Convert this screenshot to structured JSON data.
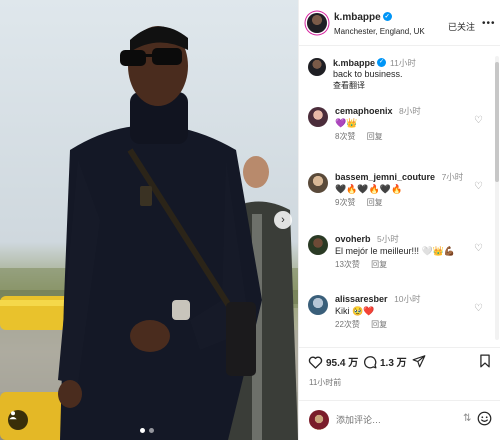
{
  "header": {
    "username": "k.mbappe",
    "location": "Manchester, England, UK",
    "follow_label": "已关注",
    "more_icon": "more-horizontal-icon"
  },
  "caption": {
    "username": "k.mbappe",
    "time": "11小时",
    "text": "back to business.",
    "translate": "查看翻译"
  },
  "comments": [
    {
      "username": "cemaphoenix",
      "time": "8小时",
      "text": "💜👑",
      "likes": "8次赞",
      "reply": "回复"
    },
    {
      "username": "bassem_jemni_couture",
      "time": "7小时",
      "text": "🖤🔥🖤🔥🖤🔥",
      "likes": "9次赞",
      "reply": "回复"
    },
    {
      "username": "ovoherb",
      "time": "5小时",
      "text": "El mejór le meilleur!!! 🤍👑💪🏾",
      "likes": "13次赞",
      "reply": "回复"
    },
    {
      "username": "alissaresber",
      "time": "10小时",
      "text": "Kiki 🥹❤️",
      "likes": "22次赞",
      "reply": "回复"
    }
  ],
  "actions": {
    "likes": "95.4 万",
    "comments": "1.3 万",
    "posted": "11小时前"
  },
  "composer": {
    "placeholder": "添加评论…"
  },
  "colors": {
    "verified": "#0095f6",
    "story_ring": "#d6249f",
    "text": "#262626",
    "muted": "#737373"
  }
}
